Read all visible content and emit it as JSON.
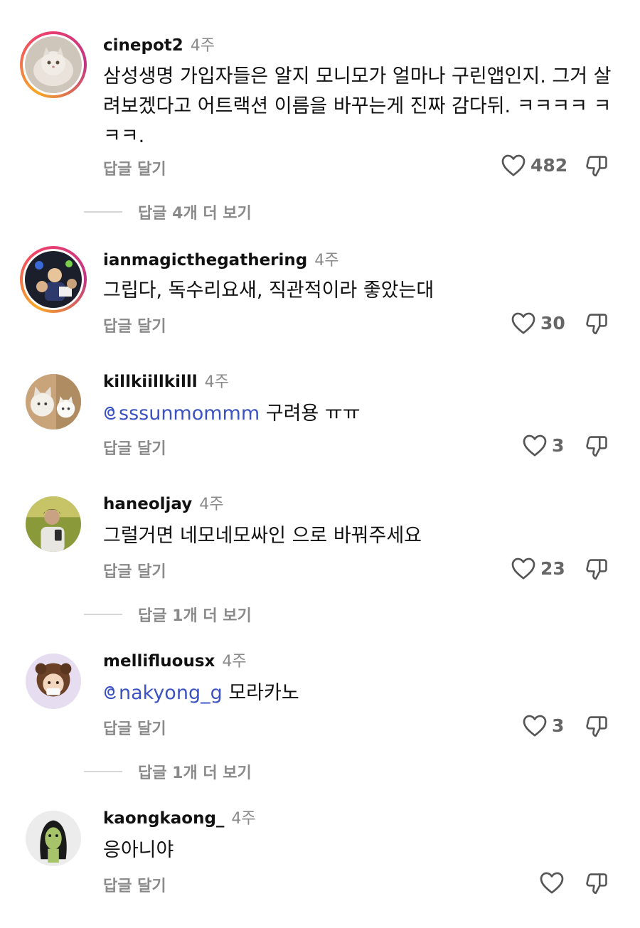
{
  "comments": [
    {
      "username": "cinepot2",
      "time": "4주",
      "text": "삼성생명 가입자들은 알지 모니모가 얼마나 구린앱인지. 그거 살려보겠다고 어트랙션 이름을 바꾸는게 진짜 감다뒤. ㅋㅋㅋㅋ ㅋㅋㅋ.",
      "reply_label": "답글 달기",
      "likes": "482",
      "more_replies": "답글 4개 더 보기"
    },
    {
      "username": "ianmagicthegathering",
      "time": "4주",
      "text": "그립다, 독수리요새, 직관적이라 좋았는대",
      "reply_label": "답글 달기",
      "likes": "30"
    },
    {
      "username": "killkiillkilll",
      "time": "4주",
      "mention": "sssunmommm",
      "text": "구려용 ㅠㅠ",
      "reply_label": "답글 달기",
      "likes": "3"
    },
    {
      "username": "haneoljay",
      "time": "4주",
      "text": "그럴거면 네모네모싸인 으로 바꿔주세요",
      "reply_label": "답글 달기",
      "likes": "23",
      "more_replies": "답글 1개 더 보기"
    },
    {
      "username": "mellifluousx",
      "time": "4주",
      "mention": "nakyong_g",
      "text": "모라카노",
      "reply_label": "답글 달기",
      "likes": "3",
      "more_replies": "답글 1개 더 보기"
    },
    {
      "username": "kaongkaong_",
      "time": "4주",
      "text": "응아니야",
      "reply_label": "답글 달기",
      "likes": ""
    }
  ],
  "colors": {
    "mention": "#3a52c4",
    "muted": "#8a8a8a",
    "story_ring": [
      "#f9a825",
      "#f0416b",
      "#c13584"
    ]
  },
  "icons": {
    "like": "heart-outline-icon",
    "dislike": "thumbs-down-outline-icon",
    "mention": "threads-at-icon"
  }
}
